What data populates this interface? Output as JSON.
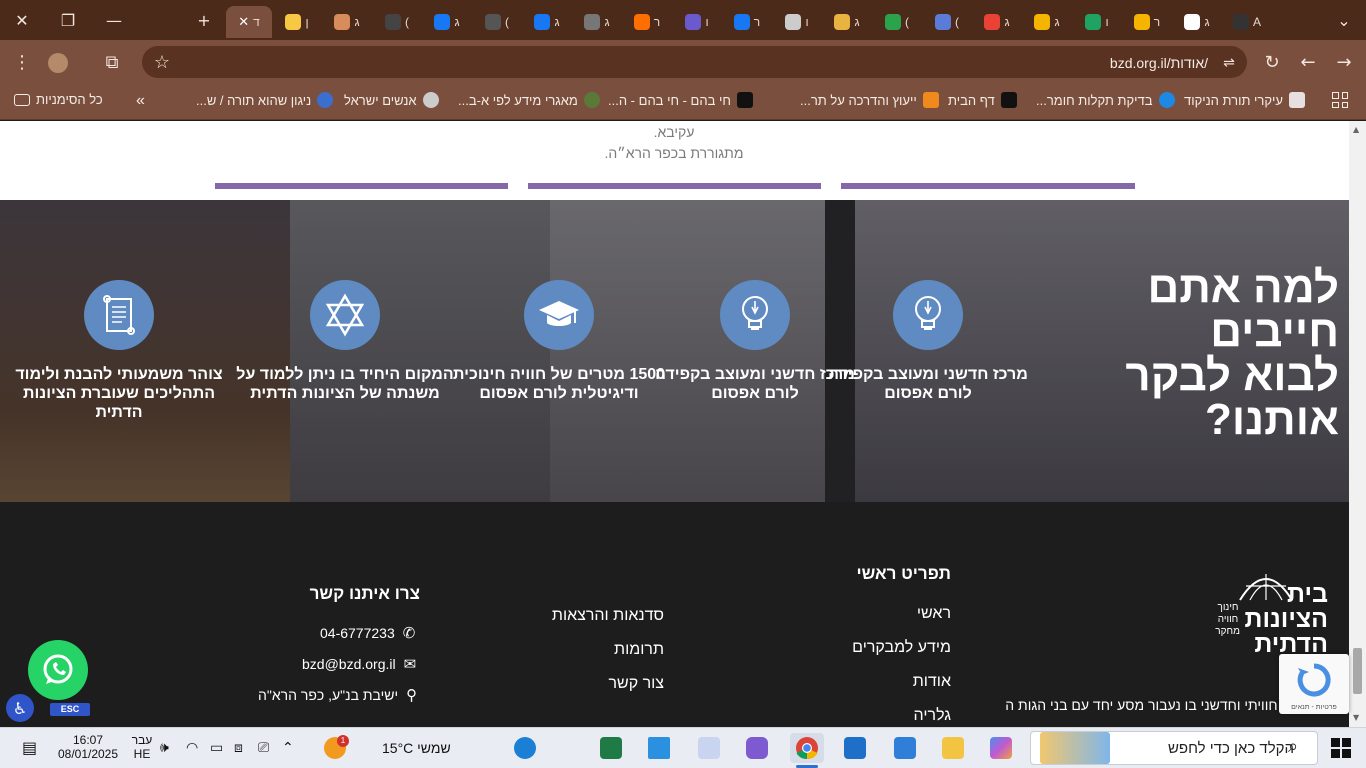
{
  "browser": {
    "tabs_visible": [
      "ד",
      "ן",
      "ג",
      "(",
      "ג",
      "(",
      "ג",
      "ג",
      "ר",
      "ו",
      "ר",
      "ו",
      "ג",
      "(",
      "(",
      "ג",
      "ג",
      "ו",
      "ר",
      "ג",
      "A"
    ],
    "url": "bzd.org.il/אודות/",
    "bookmarks": [
      "עיקרי תורת הניקוד",
      "בדיקת תקלות חומר...",
      "דף הבית",
      "ייעוץ והדרכה על תר...",
      "חי בהם - חי בהם - ה...",
      "מאגרי מידע לפי א-ב...",
      "אנשים ישראל",
      "ניגון שהוא תורה / ש..."
    ],
    "all_bookmarks_label": "כל הסימניות",
    "overflow": "»"
  },
  "page": {
    "quote_lines": [
      "עקיבא.",
      "מתגוררת בכפר הרא״ה."
    ],
    "hero": {
      "title": "למה אתם חייבים לבוא לבקר אותנו?",
      "features": [
        {
          "icon": "pen-bulb-icon",
          "text": "מרכז חדשני ומעוצב בקפידה לורם אפסום"
        },
        {
          "icon": "pen-bulb-icon",
          "text": "מרכז חדשני ומעוצב בקפידה לורם אפסום"
        },
        {
          "icon": "graduation-cap-icon",
          "text": "1500 מטרים של חוויה חינוכית ודיגיטלית לורם אפסום"
        },
        {
          "icon": "star-of-david-icon",
          "text": "המקום היחיד בו ניתן ללמוד על משנתה של הציונות הדתית"
        },
        {
          "icon": "scroll-icon",
          "text": "צוהר משמעותי להבנת ולימוד התהליכים שעוברת הציונות הדתית"
        }
      ]
    },
    "footer": {
      "logo_text": "בית הציונות הדתית",
      "logo_sub": "חינוך חוויה מחקר",
      "desc": "ים חינוכי, חוויתי וחדשני בו נעבור מסע יחד עם בני הגות הציונות הדתית",
      "menu_title": "תפריט ראשי",
      "menu": [
        "ראשי",
        "מידע למבקרים",
        "אודות",
        "גלריה"
      ],
      "menu2": [
        "סדנאות והרצאות",
        "תרומות",
        "צור קשר"
      ],
      "contact_title": "צרו איתנו קשר",
      "phone": "04-6777233",
      "email": "bzd@bzd.org.il",
      "address": "ישיבת בנ\"ע, כפר הרא\"ה"
    },
    "recaptcha": "פרטיות - תנאים",
    "esc_label": "ESC"
  },
  "taskbar": {
    "search_placeholder": "הקלד כאן כדי לחפש",
    "weather": "שמשי  15°C",
    "lang_top": "עבר",
    "lang_bottom": "HE",
    "time": "16:07",
    "date": "08/01/2025",
    "badge": "1"
  }
}
